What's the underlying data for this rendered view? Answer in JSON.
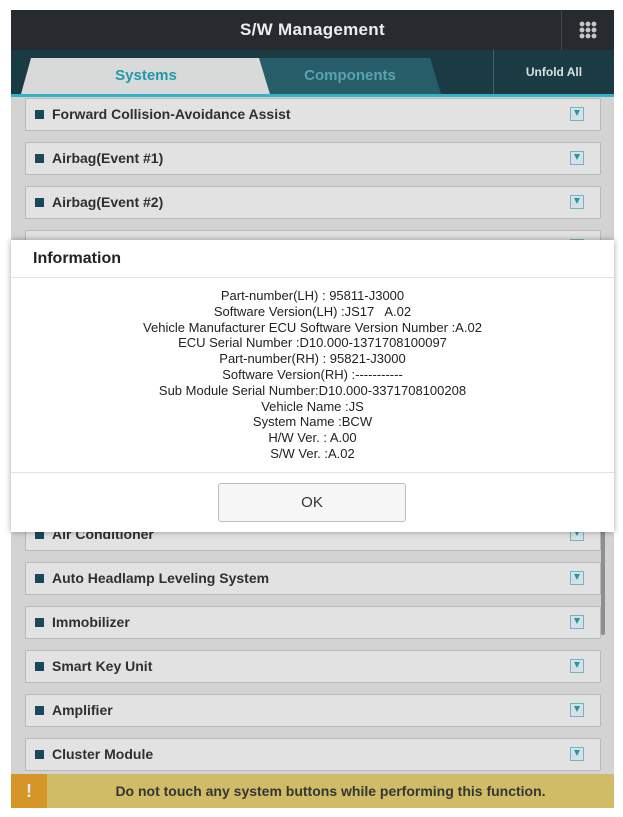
{
  "header": {
    "title": "S/W Management",
    "menu_icon": "grid-icon"
  },
  "tabs": [
    {
      "label": "Systems",
      "active": true
    },
    {
      "label": "Components",
      "active": false
    }
  ],
  "unfold_all_label": "Unfold All",
  "systems": [
    {
      "label": "Forward Collision-Avoidance Assist"
    },
    {
      "label": "Airbag(Event #1)"
    },
    {
      "label": "Airbag(Event #2)"
    },
    {
      "label": "Air Conditioner"
    },
    {
      "label": "Auto Headlamp Leveling System"
    },
    {
      "label": "Immobilizer"
    },
    {
      "label": "Smart Key Unit"
    },
    {
      "label": "Amplifier"
    },
    {
      "label": "Cluster Module"
    }
  ],
  "warning": {
    "icon": "!",
    "message": "Do not touch any system buttons while performing this function."
  },
  "dialog": {
    "title": "Information",
    "lines": [
      "Part-number(LH) : 95811-J3000",
      "Software Version(LH) :JS17   A.02",
      "Vehicle Manufacturer ECU Software Version Number :A.02",
      "ECU Serial Number :D10.000-1371708100097",
      "Part-number(RH) : 95821-J3000",
      "Software Version(RH) :-----------",
      "Sub Module Serial Number:D10.000-3371708100208",
      "Vehicle Name :JS",
      "System Name :BCW",
      "H/W Ver. : A.00",
      "S/W Ver. :A.02"
    ],
    "ok_label": "OK"
  },
  "colors": {
    "titlebar": "#2b2f33",
    "tabbar": "#1d3f4a",
    "accent": "#23a6b8",
    "warning": "#e0cb6e"
  }
}
